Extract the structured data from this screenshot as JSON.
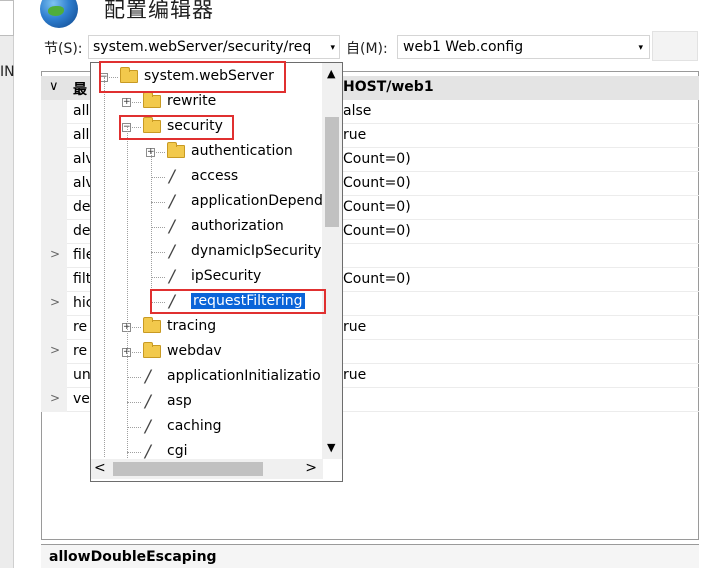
{
  "window": {
    "title": "配置编辑器",
    "left_fragment": "IN"
  },
  "toolbar": {
    "section_label": "节(S):",
    "section_value": "system.webServer/security/req",
    "from_label": "自(M):",
    "from_value": "web1 Web.config"
  },
  "grid": {
    "header_category": "最",
    "header_host": "HOST/web1",
    "rows": [
      {
        "name": "all",
        "value": "alse",
        "expandable": false
      },
      {
        "name": "all",
        "value": "rue",
        "expandable": false
      },
      {
        "name": "alv",
        "value": "Count=0)",
        "expandable": false
      },
      {
        "name": "alv",
        "value": "Count=0)",
        "expandable": false
      },
      {
        "name": "de",
        "value": "Count=0)",
        "expandable": false
      },
      {
        "name": "de",
        "value": "Count=0)",
        "expandable": false
      },
      {
        "name": "file",
        "value": "",
        "expandable": true
      },
      {
        "name": "filt",
        "value": "Count=0)",
        "expandable": false
      },
      {
        "name": "hic",
        "value": "",
        "expandable": true
      },
      {
        "name": "re",
        "value": "rue",
        "expandable": false
      },
      {
        "name": "re",
        "value": "",
        "expandable": true
      },
      {
        "name": "un",
        "value": "rue",
        "expandable": false
      },
      {
        "name": "ve",
        "value": "",
        "expandable": true
      }
    ],
    "description_title": "allowDoubleEscaping"
  },
  "tree": {
    "nodes": [
      {
        "label": "system.webServer",
        "type": "folder",
        "expander": "minus",
        "level": 0
      },
      {
        "label": "rewrite",
        "type": "folder",
        "expander": "plus",
        "level": 1
      },
      {
        "label": "security",
        "type": "folder",
        "expander": "minus",
        "level": 1
      },
      {
        "label": "authentication",
        "type": "folder",
        "expander": "plus",
        "level": 2
      },
      {
        "label": "access",
        "type": "item",
        "level": 2
      },
      {
        "label": "applicationDepende",
        "type": "item",
        "level": 2
      },
      {
        "label": "authorization",
        "type": "item",
        "level": 2
      },
      {
        "label": "dynamicIpSecurity",
        "type": "item",
        "level": 2
      },
      {
        "label": "ipSecurity",
        "type": "item",
        "level": 2
      },
      {
        "label": "requestFiltering",
        "type": "item",
        "level": 2,
        "selected": true
      },
      {
        "label": "tracing",
        "type": "folder",
        "expander": "plus",
        "level": 1
      },
      {
        "label": "webdav",
        "type": "folder",
        "expander": "plus",
        "level": 1
      },
      {
        "label": "applicationInitializatio",
        "type": "item",
        "level": 1
      },
      {
        "label": "asp",
        "type": "item",
        "level": 1
      },
      {
        "label": "caching",
        "type": "item",
        "level": 1
      },
      {
        "label": "cgi",
        "type": "item",
        "level": 1
      }
    ]
  },
  "icons": {
    "dropdown_arrow": "▾",
    "scroll_up": "▲",
    "scroll_down": "▼",
    "scroll_left": "<",
    "scroll_right": ">",
    "row_expand": ">",
    "group_collapse": "∨",
    "item_pen": "/"
  },
  "colors": {
    "selection": "#0a64d8",
    "highlight_box": "#e03030"
  }
}
